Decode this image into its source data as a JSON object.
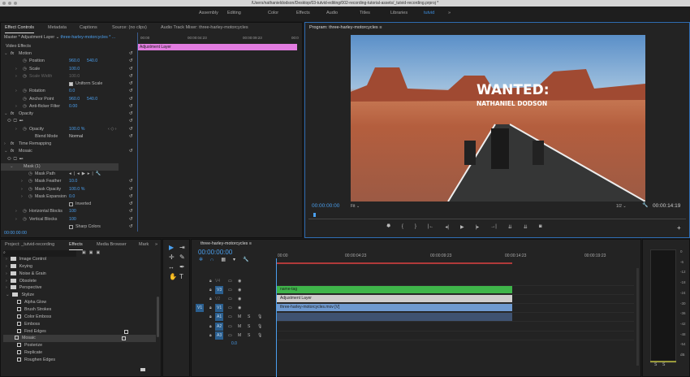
{
  "window": {
    "title": "/Users/nathanieldodson/Desktop/03-tutvid-editing/002-recording-tutorial-assets/_tutvid-recording.prproj *"
  },
  "workspaces": [
    "Assembly",
    "Editing",
    "Color",
    "Effects",
    "Audio",
    "Titles",
    "Libraries",
    "tutvid"
  ],
  "workspace_active": "tutvid",
  "workspace_more": "»",
  "top_tabs": [
    "Effect Controls",
    "Metadata",
    "Captions",
    "Source: (no clips)",
    "Audio Track Mixer: three-harley-motorcycles"
  ],
  "effect_controls": {
    "master": "Master * Adjustment Layer",
    "sequence": "three-harley-motorcycles * ...",
    "mini_times": [
      "00:00",
      "00:00:04:23",
      "00:00:09:23",
      "00:0"
    ],
    "clip_label": "Adjustment Layer",
    "section": "Video Effects",
    "rows": [
      {
        "label": "Motion",
        "fx": true,
        "tw": "⌄",
        "ind": 0
      },
      {
        "label": "Position",
        "v1": "960.0",
        "v2": "540.0",
        "ind": 2,
        "sw": true
      },
      {
        "label": "Scale",
        "v1": "100.0",
        "ind": 2,
        "tw": "›",
        "sw": true
      },
      {
        "label": "Scale Width",
        "v1": "100.0",
        "ind": 2,
        "tw": "›",
        "sw": true,
        "dim": true
      },
      {
        "label": "",
        "check": "Uniform Scale",
        "checked": true
      },
      {
        "label": "Rotation",
        "v1": "0.0",
        "ind": 2,
        "tw": "›",
        "sw": true
      },
      {
        "label": "Anchor Point",
        "v1": "960.0",
        "v2": "540.0",
        "ind": 2,
        "sw": true
      },
      {
        "label": "Anti-flicker Filter",
        "v1": "0.00",
        "ind": 2,
        "tw": "›",
        "sw": true
      },
      {
        "label": "Opacity",
        "fx": true,
        "tw": "⌄",
        "ind": 0
      },
      {
        "label": "",
        "shapes": true
      },
      {
        "label": "Opacity",
        "v1": "100.0 %",
        "ind": 2,
        "tw": "›",
        "sw": true,
        "kf": true
      },
      {
        "label": "Blend Mode",
        "v1": "Normal",
        "ind": 3,
        "select": true
      },
      {
        "label": "Time Remapping",
        "fx": true,
        "tw": "›",
        "ind": 0,
        "noreset": true
      },
      {
        "label": "Mosaic",
        "fx": true,
        "tw": "⌄",
        "ind": 0
      },
      {
        "label": "",
        "shapes": true,
        "noreset": true
      },
      {
        "label": "Mask (1)",
        "tw": "⌄",
        "ind": 1,
        "hl": true,
        "noreset": true
      },
      {
        "label": "Mask Path",
        "ind": 3,
        "sw": true,
        "maskpath": true,
        "noreset": true
      },
      {
        "label": "Mask Feather",
        "v1": "10.0",
        "ind": 3,
        "tw": "›",
        "sw": true
      },
      {
        "label": "Mask Opacity",
        "v1": "100.0 %",
        "ind": 3,
        "tw": "›",
        "sw": true
      },
      {
        "label": "Mask Expansion",
        "v1": "0.0",
        "ind": 3,
        "tw": "›",
        "sw": true
      },
      {
        "label": "",
        "check": "Inverted",
        "checked": false
      },
      {
        "label": "Horizontal Blocks",
        "v1": "100",
        "ind": 2,
        "tw": "›",
        "sw": true
      },
      {
        "label": "Vertical Blocks",
        "v1": "100",
        "ind": 2,
        "tw": "›",
        "sw": true
      },
      {
        "label": "",
        "check": "Sharp Colors",
        "checked": false
      }
    ],
    "timecode": "00:00:00:00"
  },
  "program": {
    "title": "Program: three-harley-motorcycles",
    "overlay_line1": "WANTED:",
    "overlay_line2": "NATHANIEL DODSON",
    "timecode": "00:00:00:00",
    "fit": "Fit",
    "resolution": "1/2",
    "duration": "00:00:14:19",
    "controls": [
      "marker-icon",
      "mark-in-icon",
      "mark-out-icon",
      "go-to-in-icon",
      "step-back-icon",
      "play-icon",
      "step-forward-icon",
      "go-to-out-icon",
      "insert-icon",
      "overwrite-icon",
      "export-frame-icon"
    ],
    "control_glyphs": [
      "⯂",
      "{",
      "}",
      "|←",
      "◂|",
      "▶",
      "|▸",
      "→|",
      "⇊",
      "⇊",
      "◙"
    ],
    "add": "+"
  },
  "project_panel": {
    "tabs": [
      "Project: _tutvid-recording",
      "Effects",
      "Media Browser",
      "Mark"
    ],
    "more": "»",
    "items": [
      {
        "label": "Image Control",
        "type": "folder"
      },
      {
        "label": "Keying",
        "type": "folder"
      },
      {
        "label": "Noise & Grain",
        "type": "folder"
      },
      {
        "label": "Obsolete",
        "type": "folder"
      },
      {
        "label": "Perspective",
        "type": "folder"
      },
      {
        "label": "Stylize",
        "type": "folder",
        "open": true
      },
      {
        "label": "Alpha Glow",
        "type": "fx"
      },
      {
        "label": "Brush Strokes",
        "type": "fx"
      },
      {
        "label": "Color Emboss",
        "type": "fx"
      },
      {
        "label": "Emboss",
        "type": "fx"
      },
      {
        "label": "Find Edges",
        "type": "fx",
        "accel": true
      },
      {
        "label": "Mosaic",
        "type": "fx",
        "accel": true,
        "selected": true
      },
      {
        "label": "Posterize",
        "type": "fx"
      },
      {
        "label": "Replicate",
        "type": "fx"
      },
      {
        "label": "Roughen Edges",
        "type": "fx"
      }
    ]
  },
  "timeline": {
    "sequence": "three-harley-motorcycles",
    "timecode": "00:00:00:00",
    "ruler": [
      "00:00",
      "00:00:04:23",
      "00:00:09:23",
      "00:00:14:23",
      "00:00:19:23"
    ],
    "tracks": [
      {
        "name": "V4",
        "kind": "v"
      },
      {
        "name": "V3",
        "kind": "v",
        "on": true
      },
      {
        "name": "V2",
        "kind": "v"
      },
      {
        "name": "V1",
        "kind": "v",
        "on": true,
        "src": "V1"
      },
      {
        "name": "A1",
        "kind": "a",
        "on": true
      },
      {
        "name": "A2",
        "kind": "a",
        "on": true
      },
      {
        "name": "A3",
        "kind": "a",
        "on": true
      }
    ],
    "master_value": "0.0",
    "clips": [
      {
        "label": "name-tag",
        "color": "#3fb54a"
      },
      {
        "label": "Adjustment Layer",
        "color": "#cfcdcd"
      },
      {
        "label": "three-harley-motorcycles.mov [V]",
        "color": "#6f9ad0"
      }
    ]
  },
  "meter": {
    "labels": [
      "0",
      "-6",
      "-12",
      "-18",
      "-24",
      "-30",
      "-36",
      "-42",
      "-48",
      "-54",
      "dB"
    ],
    "solo": [
      "S",
      "S"
    ]
  }
}
